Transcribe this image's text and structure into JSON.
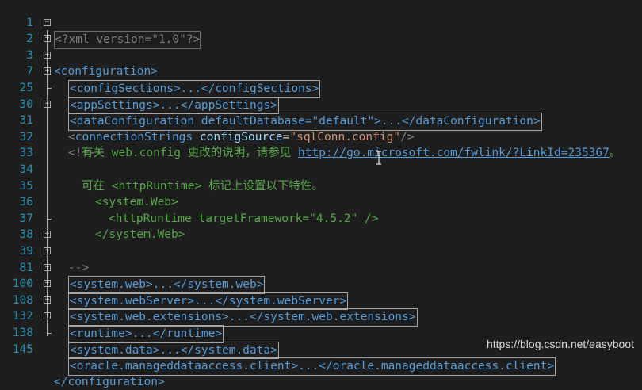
{
  "editor": {
    "line_numbers": [
      "1",
      "2",
      "3",
      "7",
      "25",
      "30",
      "31",
      "32",
      "33",
      "34",
      "35",
      "36",
      "37",
      "38",
      "39",
      "81",
      "100",
      "108",
      "132",
      "138",
      "145"
    ],
    "xml_decl": "<?xml version=\"1.0\"?>",
    "root_open": "<configuration>",
    "root_close": "</configuration>",
    "collapsed": {
      "configSections": "<configSections>...</configSections>",
      "appSettings": "<appSettings>...</appSettings>",
      "dataConfiguration": "<dataConfiguration defaultDatabase=\"default\">...</dataConfiguration>",
      "systemWeb": "<system.web>...</system.web>",
      "webServer": "<system.webServer>...</system.webServer>",
      "webExtensions": "<system.web.extensions>...</system.web.extensions>",
      "runtime": "<runtime>...</runtime>",
      "systemData": "<system.data>...</system.data>",
      "oracle": "<oracle.manageddataaccess.client>...</oracle.manageddataaccess.client>"
    },
    "connection_strings": {
      "open": "<",
      "tag": "connectionStrings",
      "attr": "configSource",
      "eq": "=",
      "value": "\"sqlConn.config\"",
      "close": "/>"
    },
    "comment": {
      "open": "<!--",
      "line32_text": "有关 web.config 更改的说明，请参见 ",
      "line32_link": "http://go.microsoft.com/fwlink/?LinkId=235367",
      "line32_end": "。",
      "line34": "可在 <httpRuntime> 标记上设置以下特性。",
      "line35": "<system.Web>",
      "line36": "<httpRuntime targetFramework=\"4.5.2\" />",
      "line37": "</system.Web>",
      "close": "-->"
    }
  },
  "watermark": "https://blog.csdn.net/easyboot",
  "colors": {
    "background": "#1e1e1e",
    "line_number": "#2b91af",
    "tag": "#569cd6",
    "attribute": "#9cdcfe",
    "value": "#ce9178",
    "comment": "#57a64a",
    "delimiter": "#808080"
  }
}
